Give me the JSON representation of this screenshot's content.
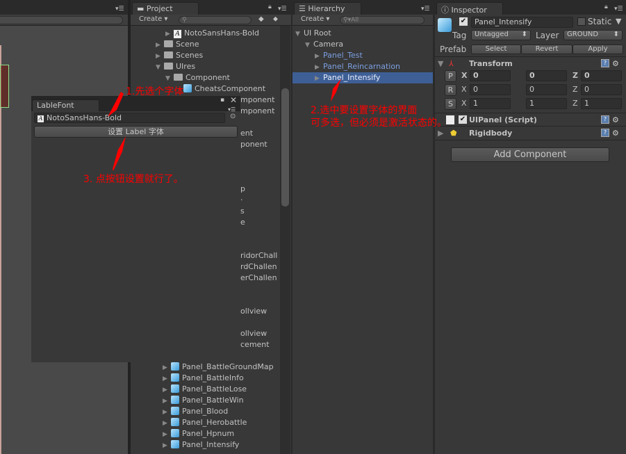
{
  "scene": {
    "menu_icon": "menu-icon"
  },
  "project": {
    "tab": "Project",
    "create": "Create ▾",
    "items": [
      {
        "label": "NotoSansHans-Bold",
        "icon": "font",
        "indent": 3,
        "tri": "▶"
      },
      {
        "label": "Scene",
        "icon": "folder",
        "indent": 2,
        "tri": "▶"
      },
      {
        "label": "Scenes",
        "icon": "folder",
        "indent": 2,
        "tri": "▶"
      },
      {
        "label": "UIres",
        "icon": "folder",
        "indent": 2,
        "tri": "▼"
      },
      {
        "label": "Component",
        "icon": "folder",
        "indent": 3,
        "tri": "▼"
      },
      {
        "label": "CheatsComponent",
        "icon": "prefab",
        "indent": 4,
        "tri": ""
      }
    ],
    "clipped": [
      {
        "row": 6,
        "text": "mponent"
      },
      {
        "row": 7,
        "text": "mponent"
      },
      {
        "row": 9,
        "text": "ent"
      },
      {
        "row": 10,
        "text": "ponent"
      },
      {
        "row": 14,
        "text": "p"
      },
      {
        "row": 15,
        "text": "·"
      },
      {
        "row": 16,
        "text": "s"
      },
      {
        "row": 17,
        "text": "e"
      },
      {
        "row": 20,
        "text": "ridorChall"
      },
      {
        "row": 21,
        "text": "rdChallen"
      },
      {
        "row": 22,
        "text": "erChallen"
      },
      {
        "row": 25,
        "text": "ollview"
      },
      {
        "row": 27,
        "text": "ollview"
      },
      {
        "row": 28,
        "text": "cement"
      }
    ],
    "panels": [
      "Panel_BattleGroundMap",
      "Panel_BattleInfo",
      "Panel_BattleLose",
      "Panel_BattleWin",
      "Panel_Blood",
      "Panel_Herobattle",
      "Panel_Hpnum",
      "Panel_Intensify"
    ]
  },
  "hierarchy": {
    "tab": "Hierarchy",
    "create": "Create ▾",
    "search_placeholder": "All",
    "items": [
      {
        "label": "UI Root",
        "indent": 0,
        "tri": "▼",
        "prefab": false
      },
      {
        "label": "Camera",
        "indent": 1,
        "tri": "▼",
        "prefab": false
      },
      {
        "label": "Panel_Test",
        "indent": 2,
        "tri": "▶",
        "prefab": true
      },
      {
        "label": "Panel_Reincarnation",
        "indent": 2,
        "tri": "▶",
        "prefab": true
      },
      {
        "label": "Panel_Intensify",
        "indent": 2,
        "tri": "▶",
        "prefab": true,
        "selected": true
      }
    ]
  },
  "inspector": {
    "tab": "Inspector",
    "name": "Panel_Intensify",
    "static_label": "Static",
    "tag_label": "Tag",
    "tag_value": "Untagged",
    "layer_label": "Layer",
    "layer_value": "GROUND",
    "prefab_label": "Prefab",
    "select": "Select",
    "revert": "Revert",
    "apply": "Apply",
    "transform": {
      "title": "Transform",
      "rows": [
        {
          "btn": "P",
          "x": "0",
          "y": "0",
          "z": "0"
        },
        {
          "btn": "R",
          "x": "0",
          "y": "0",
          "z": "0"
        },
        {
          "btn": "S",
          "x": "1",
          "y": "1",
          "z": "1"
        }
      ]
    },
    "axis_x": "X",
    "axis_y": "Y",
    "axis_z": "Z",
    "uipanel": "UIPanel (Script)",
    "rigidbody": "Rigidbody",
    "add_component": "Add Component"
  },
  "lablefont": {
    "tab": "LableFont",
    "font_value": "NotoSansHans-Bold",
    "button": "设置 Label 字体"
  },
  "annotations": {
    "step1": "1.先选个字体",
    "step2_line1": "2.选中要设置字体的界面",
    "step2_line2": "可多选，但必须是激活状态的。",
    "step3": "3. 点按钮设置就行了。"
  },
  "colors": {
    "selection": "#3e5f96",
    "prefab_text": "#7b9fe0",
    "annotation": "#ff0000"
  }
}
